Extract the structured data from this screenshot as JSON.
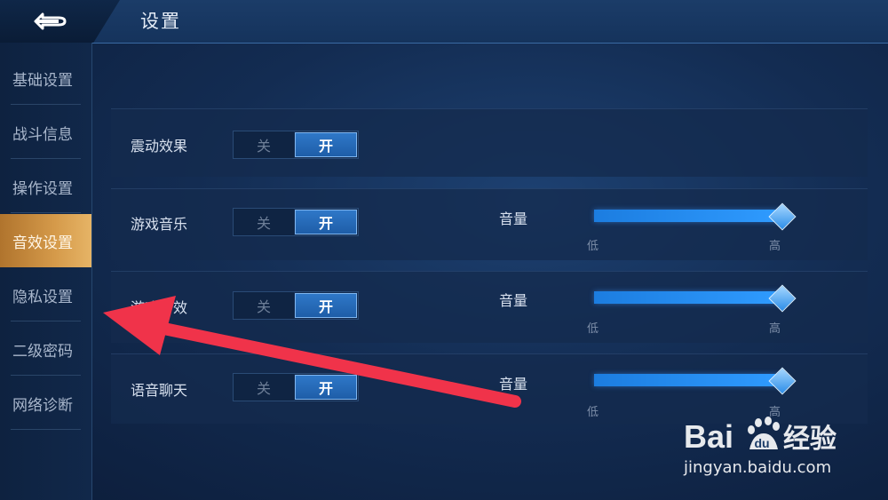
{
  "header": {
    "title": "设置",
    "back_icon": "back-arrow-icon"
  },
  "sidebar": {
    "items": [
      {
        "label": "基础设置",
        "active": false
      },
      {
        "label": "战斗信息",
        "active": false
      },
      {
        "label": "操作设置",
        "active": false
      },
      {
        "label": "音效设置",
        "active": true
      },
      {
        "label": "隐私设置",
        "active": false
      },
      {
        "label": "二级密码",
        "active": false
      },
      {
        "label": "网络诊断",
        "active": false
      }
    ]
  },
  "settings": [
    {
      "label": "震动效果",
      "off": "关",
      "on": "开",
      "state": "on"
    },
    {
      "label": "游戏音乐",
      "off": "关",
      "on": "开",
      "state": "on",
      "volume_label": "音量",
      "low": "低",
      "high": "高",
      "volume": 1.0
    },
    {
      "label": "游戏音效",
      "off": "关",
      "on": "开",
      "state": "on",
      "volume_label": "音量",
      "low": "低",
      "high": "高",
      "volume": 1.0
    },
    {
      "label": "语音聊天",
      "off": "关",
      "on": "开",
      "state": "on",
      "volume_label": "音量",
      "low": "低",
      "high": "高",
      "volume": 1.0
    }
  ],
  "watermark": {
    "brand": "Bai du 经验",
    "url": "jingyan.baidu.com"
  },
  "colors": {
    "active_tab": "#d59a4a",
    "toggle_on": "#2f78c8",
    "annotation_arrow": "#f0334a"
  }
}
